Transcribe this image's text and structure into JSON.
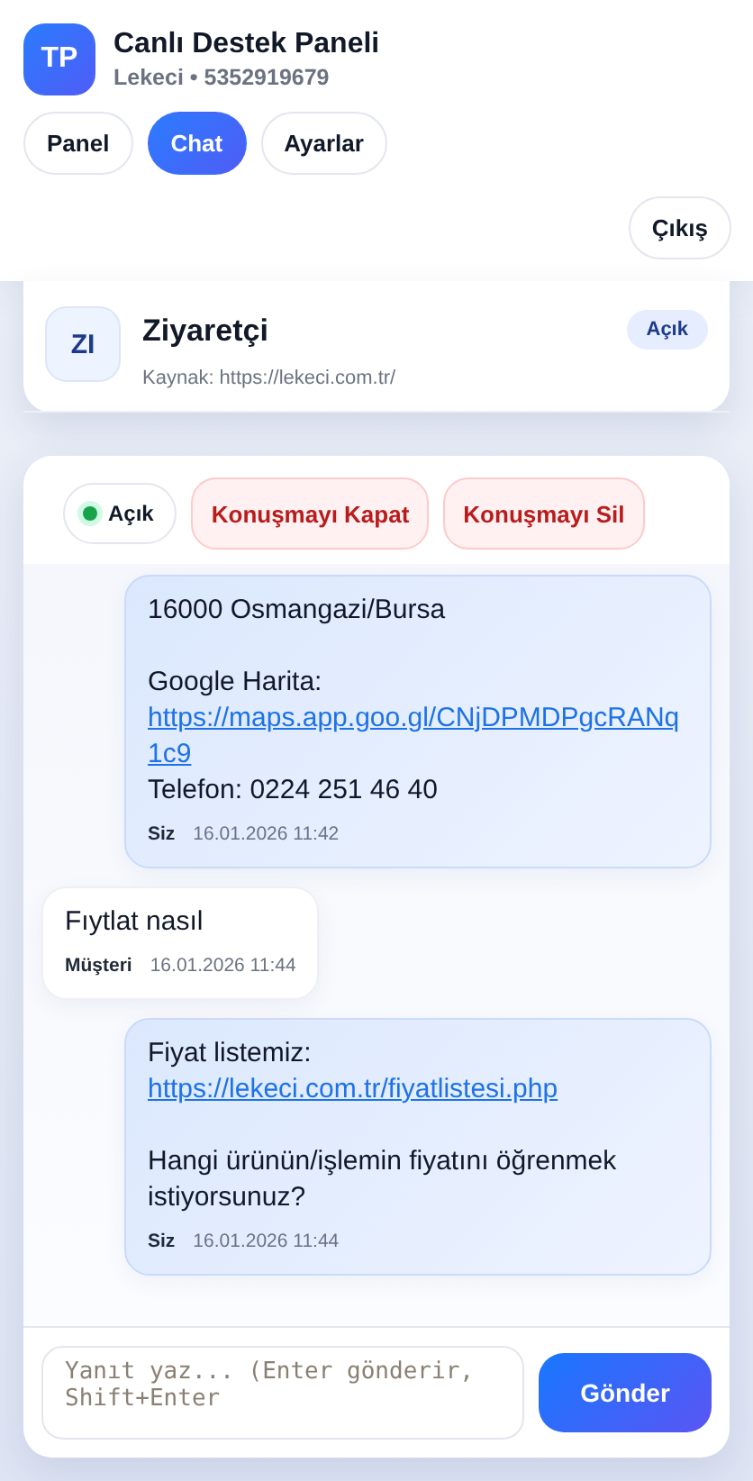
{
  "header": {
    "avatar": "TP",
    "title": "Canlı Destek Paneli",
    "subtitle": "Lekeci • 5352919679"
  },
  "tabs": [
    {
      "label": "Panel",
      "selected": false
    },
    {
      "label": "Chat",
      "selected": true
    },
    {
      "label": "Ayarlar",
      "selected": false
    }
  ],
  "logout": "Çıkış",
  "conversations": [
    {
      "initials": "ZI",
      "name": "Ziyaretçi",
      "status": "Açık",
      "source": "Kaynak: https://lekeci.com.tr/",
      "selected": false
    }
  ],
  "chat": {
    "status": {
      "label": "Açık",
      "online": true
    },
    "actions": [
      "Konuşmayı Kapat",
      "Konuşmayı Sil"
    ],
    "messages": [
      {
        "kind": "agent",
        "lines": [
          {
            "kind": "text",
            "text": "16000 Osmangazi/Bursa"
          },
          {
            "kind": "gap"
          },
          {
            "kind": "text",
            "text": "Google Harita:"
          },
          {
            "kind": "link",
            "text": "https://maps.app.goo.gl/CNjDPMDPgcRANq1c9"
          },
          {
            "kind": "text",
            "text": "Telefon: 0224 251 46 40"
          }
        ],
        "sender": "Siz",
        "time": "16.01.2026 11:42"
      },
      {
        "kind": "customer",
        "lines": [
          {
            "kind": "text",
            "text": "Fıytlat nasıl"
          }
        ],
        "sender": "Müşteri",
        "time": "16.01.2026 11:44"
      },
      {
        "kind": "agent",
        "lines": [
          {
            "kind": "text",
            "text": "Fiyat listemiz:"
          },
          {
            "kind": "link",
            "text": "https://lekeci.com.tr/fiyatlistesi.php"
          },
          {
            "kind": "gap"
          },
          {
            "kind": "text",
            "text": "Hangi ürünün/işlemin fiyatını öğrenmek istiyorsunuz?"
          }
        ],
        "sender": "Siz",
        "time": "16.01.2026 11:44"
      }
    ],
    "reply": {
      "placeholder": "Yanıt yaz... (Enter gönderir, Shift+Enter",
      "send": "Gönder"
    }
  }
}
